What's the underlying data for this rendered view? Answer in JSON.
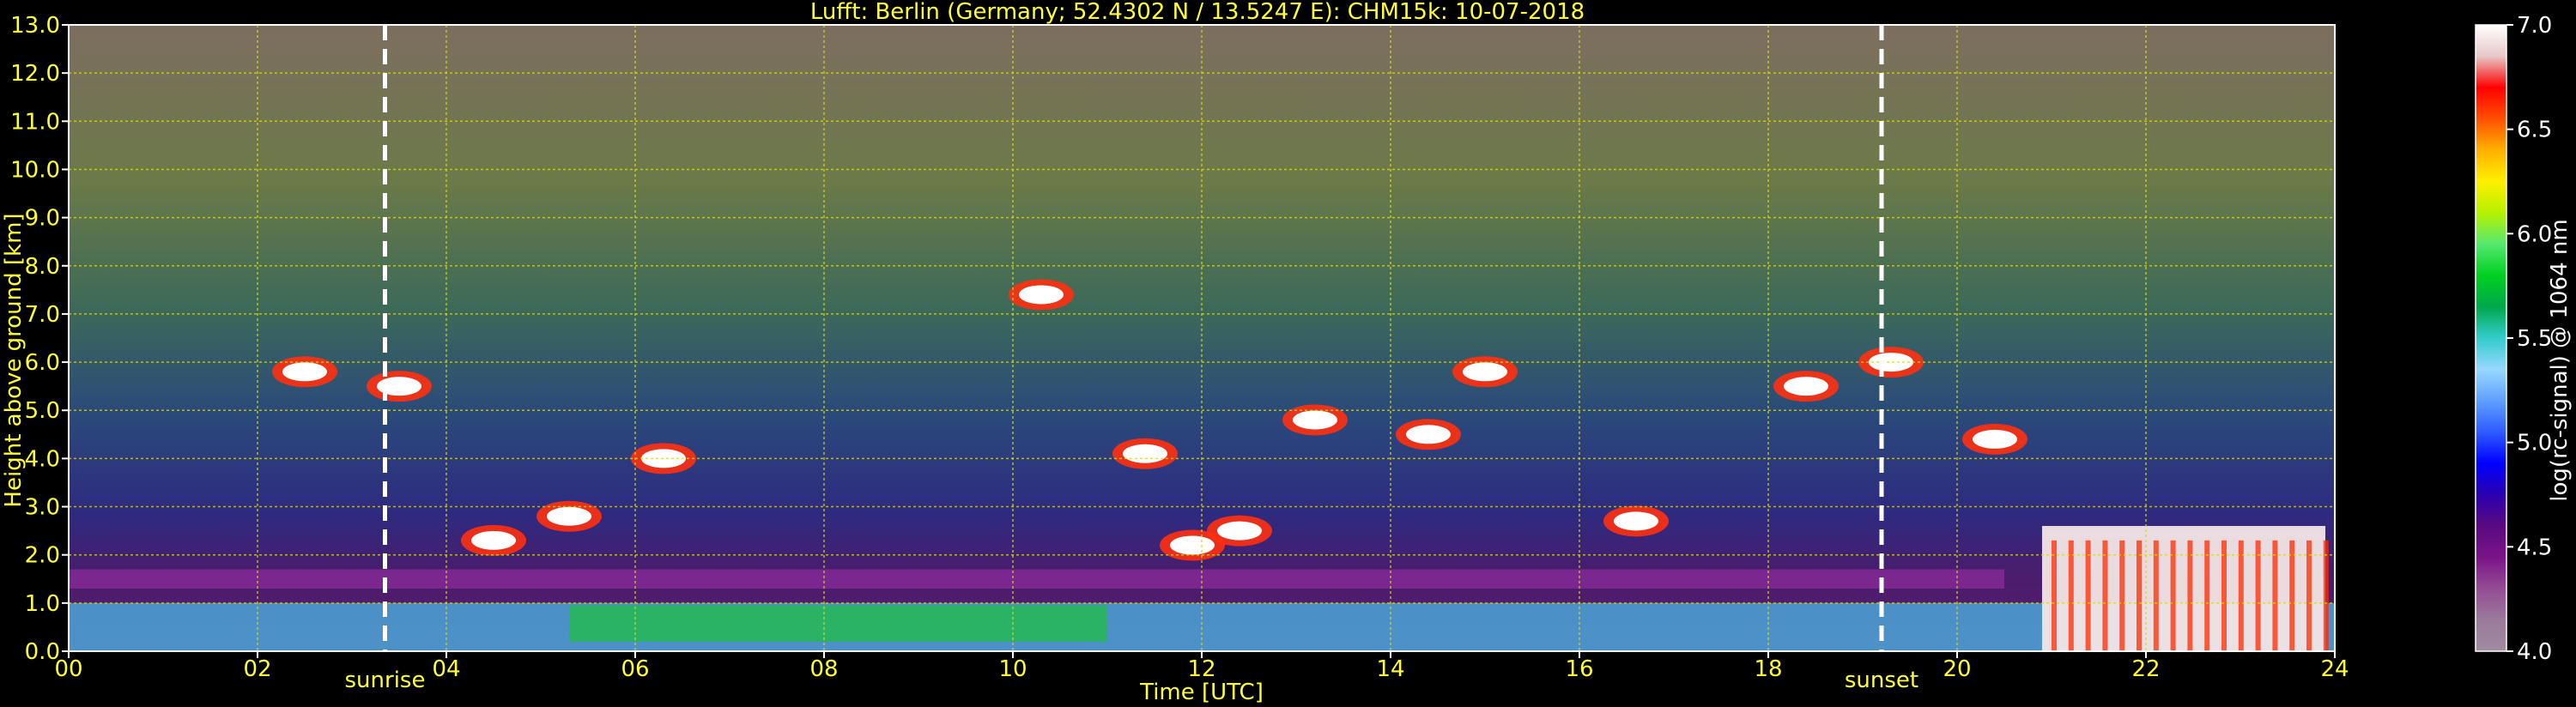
{
  "chart_data": {
    "type": "heatmap",
    "title": "Lufft: Berlin (Germany; 52.4302 N / 13.5247 E):    CHM15k: 10-07-2018",
    "xlabel": "Time [UTC]",
    "ylabel": "Height above ground [km]",
    "xlim": [
      0,
      24
    ],
    "ylim": [
      0,
      13
    ],
    "x_ticks": [
      "00",
      "02",
      "04",
      "06",
      "08",
      "10",
      "12",
      "14",
      "16",
      "18",
      "20",
      "22",
      "24"
    ],
    "y_ticks": [
      "0.0",
      "1.0",
      "2.0",
      "3.0",
      "4.0",
      "5.0",
      "6.0",
      "7.0",
      "8.0",
      "9.0",
      "10.0",
      "11.0",
      "12.0",
      "13.0"
    ],
    "grid": true,
    "colorbar": {
      "label": "log(rc-signal) @ 1064 nm",
      "range": [
        4.0,
        7.0
      ],
      "ticks": [
        "4.0",
        "4.5",
        "5.0",
        "5.5",
        "6.0",
        "6.5",
        "7.0"
      ],
      "colors": [
        "#a08ca0",
        "#9a7a9a",
        "#944c94",
        "#7a1488",
        "#5a0a80",
        "#2a00b0",
        "#0000ff",
        "#2f5bff",
        "#5ea0ff",
        "#98d8ff",
        "#33cccc",
        "#00a84a",
        "#00d020",
        "#55e870",
        "#b6f000",
        "#fff000",
        "#ffb000",
        "#ff5000",
        "#ff0000",
        "#e8c8c8",
        "#ffffff"
      ]
    },
    "annotations": [
      {
        "text": "sunrise",
        "x": 3.35
      },
      {
        "text": "sunset",
        "x": 19.2
      }
    ],
    "layers": [
      {
        "name": "surface",
        "x0": 0,
        "x1": 24,
        "h0": 0,
        "h1": 1.0
      },
      {
        "name": "boundary-layer-top",
        "x0": 0,
        "x1": 20.5,
        "h0": 1.3,
        "h1": 1.7
      },
      {
        "name": "precip-rain",
        "x0": 20.9,
        "x1": 23.9,
        "h0": 0,
        "h1": 2.6
      }
    ],
    "clouds": [
      {
        "x": 2.5,
        "h": 5.8
      },
      {
        "x": 3.5,
        "h": 5.5
      },
      {
        "x": 4.5,
        "h": 2.3
      },
      {
        "x": 5.3,
        "h": 2.8
      },
      {
        "x": 6.3,
        "h": 4.0
      },
      {
        "x": 10.3,
        "h": 7.4
      },
      {
        "x": 11.4,
        "h": 4.1
      },
      {
        "x": 11.9,
        "h": 2.2
      },
      {
        "x": 12.4,
        "h": 2.5
      },
      {
        "x": 13.2,
        "h": 4.8
      },
      {
        "x": 14.4,
        "h": 4.5
      },
      {
        "x": 15.0,
        "h": 5.8
      },
      {
        "x": 16.6,
        "h": 2.7
      },
      {
        "x": 18.4,
        "h": 5.5
      },
      {
        "x": 19.3,
        "h": 6.0
      },
      {
        "x": 20.4,
        "h": 4.4
      }
    ]
  }
}
